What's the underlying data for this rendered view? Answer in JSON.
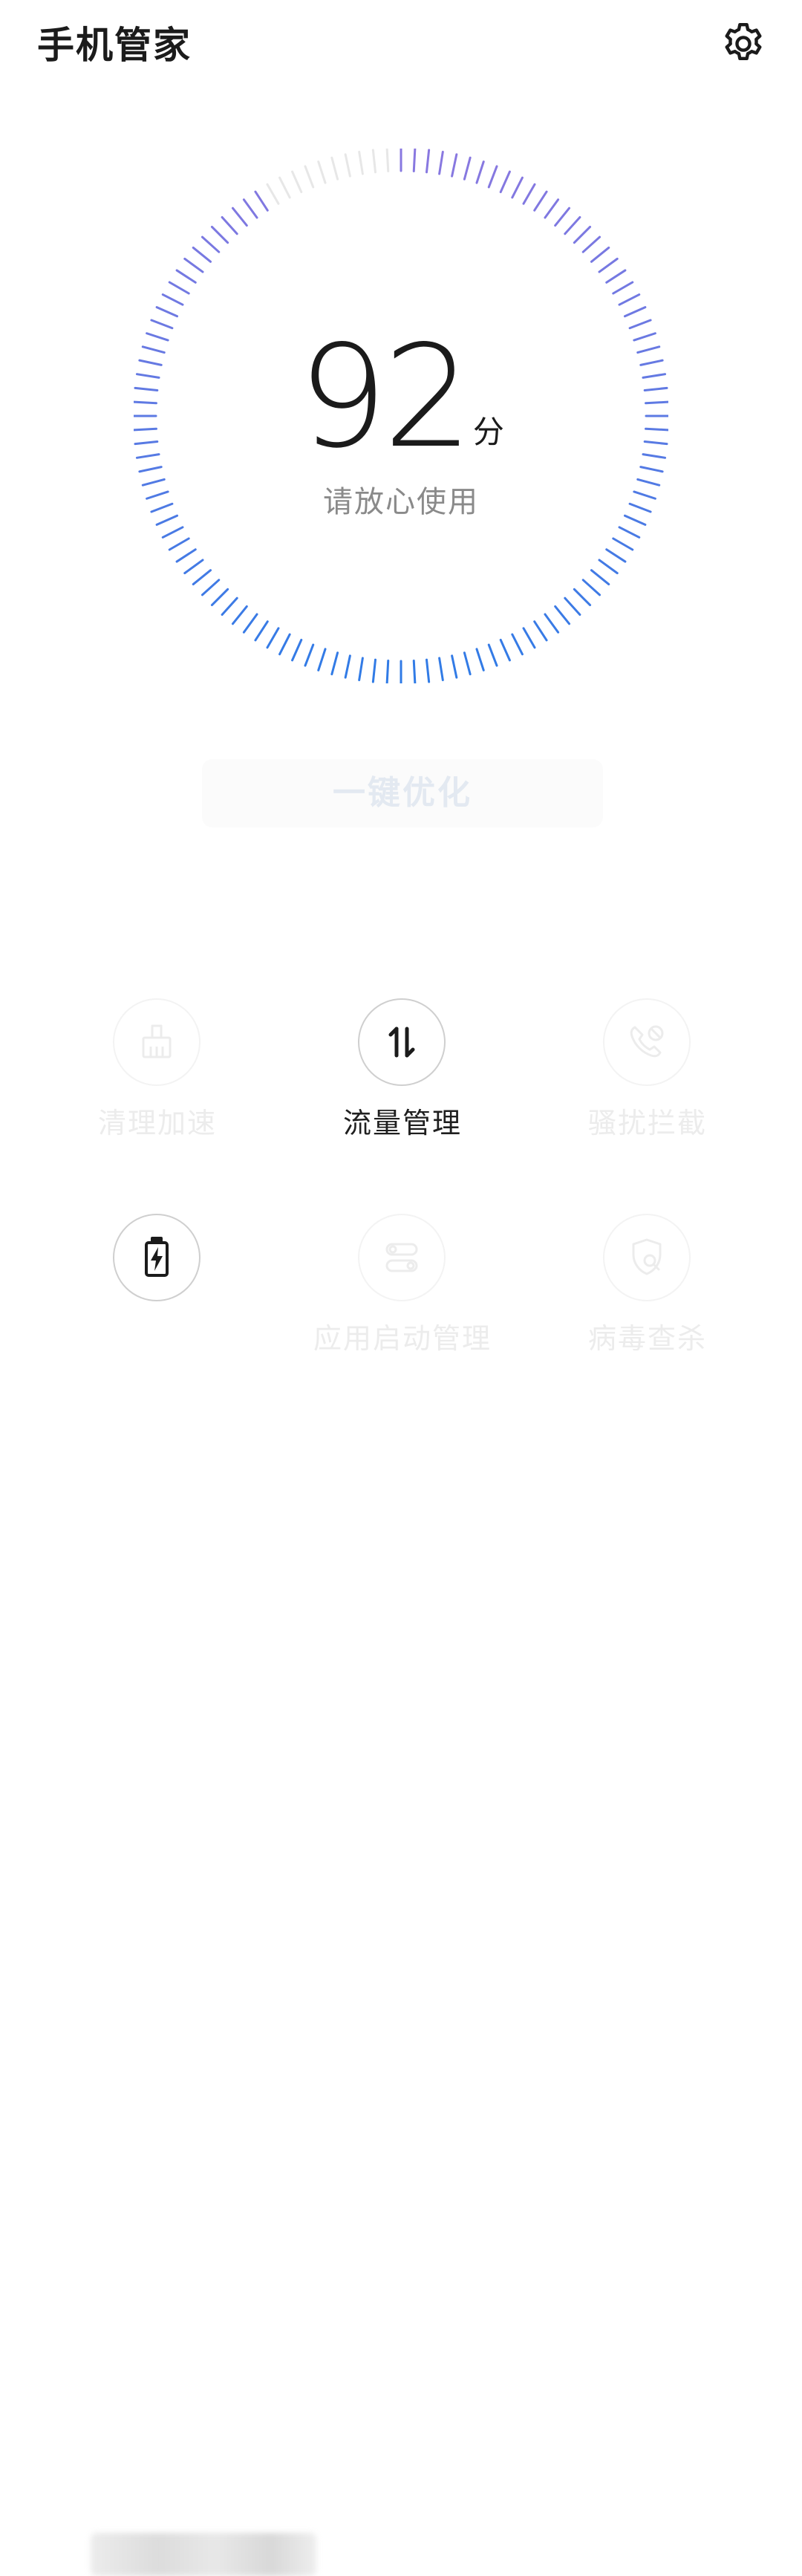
{
  "header": {
    "title": "手机管家",
    "settings_icon": "gear-icon"
  },
  "gauge": {
    "score": "92",
    "unit": "分",
    "status": "请放心使用",
    "score_value": 92,
    "max_score": 100,
    "tick_count": 120,
    "colors": {
      "gradient_start": "#8a78e0",
      "gradient_end": "#2f7be6",
      "inactive": "#e7e7e7"
    }
  },
  "optimize_button": {
    "label": "一键优化"
  },
  "tiles": [
    {
      "label": "清理加速",
      "icon": "broom-icon",
      "enabled": false
    },
    {
      "label": "流量管理",
      "icon": "data-traffic-icon",
      "enabled": true
    },
    {
      "label": "骚扰拦截",
      "icon": "blocked-call-icon",
      "enabled": false
    },
    {
      "label": "",
      "icon": "battery-charging-icon",
      "enabled": true
    },
    {
      "label": "应用启动管理",
      "icon": "app-launch-icon",
      "enabled": false
    },
    {
      "label": "病毒查杀",
      "icon": "virus-scan-shield-icon",
      "enabled": false
    }
  ]
}
